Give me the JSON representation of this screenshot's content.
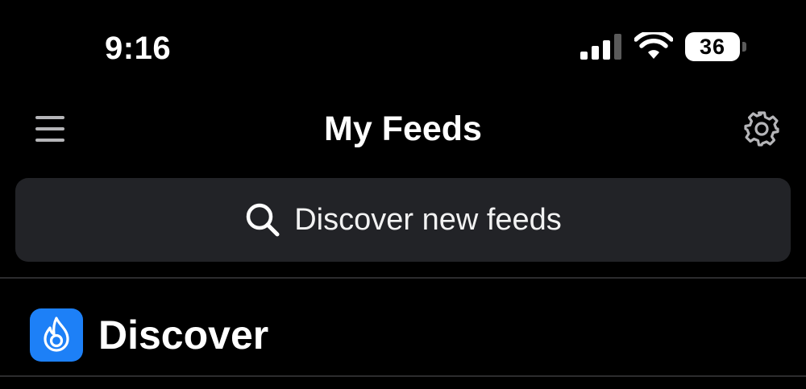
{
  "status_bar": {
    "time": "9:16",
    "battery_level": "36",
    "icons": [
      "cellular-signal-icon",
      "wifi-icon",
      "battery-icon"
    ]
  },
  "header": {
    "title": "My Feeds",
    "icons": [
      "hamburger-menu-icon",
      "gear-icon"
    ]
  },
  "search": {
    "placeholder": "Discover new feeds",
    "icon": "search-icon"
  },
  "feeds": [
    {
      "label": "Discover",
      "icon": "flame-icon",
      "icon_color": "#1d80f7"
    }
  ],
  "colors": {
    "background": "#000000",
    "search_background": "#222327",
    "divider": "#2c2c2e",
    "accent": "#1d80f7",
    "text": "#ffffff"
  }
}
